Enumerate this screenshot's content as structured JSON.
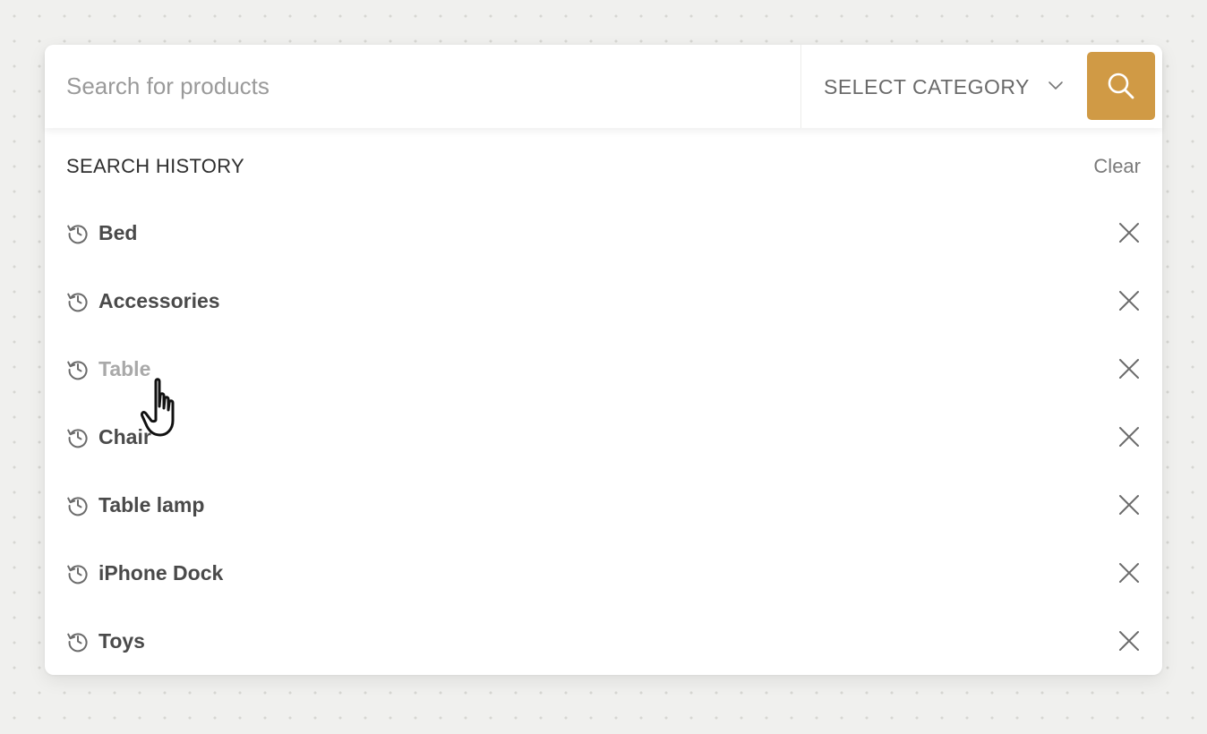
{
  "search": {
    "placeholder": "Search for products",
    "category_label": "SELECT CATEGORY",
    "button_icon": "search-icon"
  },
  "history": {
    "title": "SEARCH HISTORY",
    "clear_label": "Clear",
    "items": [
      {
        "label": "Bed",
        "state": "normal"
      },
      {
        "label": "Accessories",
        "state": "normal"
      },
      {
        "label": "Table",
        "state": "hover"
      },
      {
        "label": "Chair",
        "state": "normal"
      },
      {
        "label": "Table lamp",
        "state": "normal"
      },
      {
        "label": "iPhone Dock",
        "state": "normal"
      },
      {
        "label": "Toys",
        "state": "normal"
      }
    ],
    "item_icon": "history-icon",
    "remove_icon": "close-icon"
  },
  "colors": {
    "accent": "#d09a45",
    "background": "#f0f0ee",
    "panel": "#ffffff",
    "text": "#4a4a4a",
    "muted": "#a9a9a9"
  },
  "cursor": {
    "icon": "hand-pointer-icon"
  }
}
